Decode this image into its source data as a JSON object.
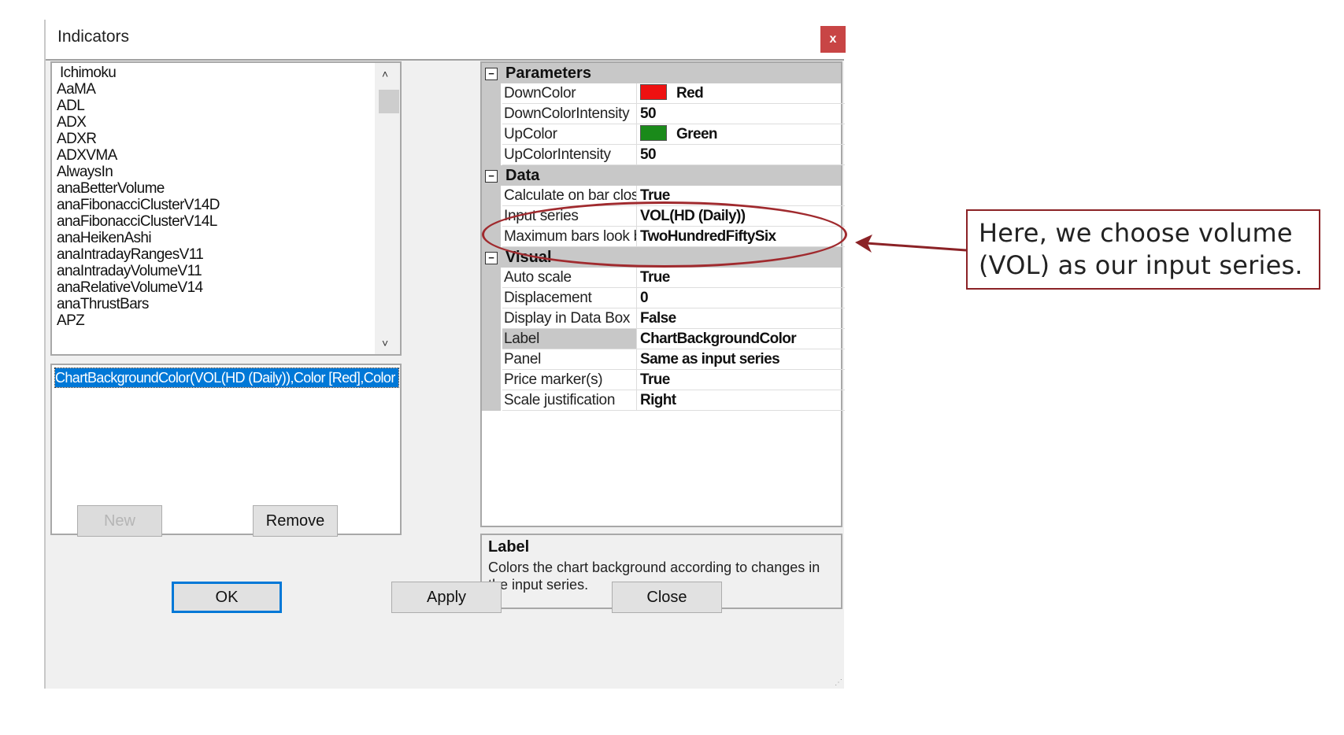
{
  "window": {
    "title": "Indicators",
    "close_glyph": "x"
  },
  "indicator_list": {
    "items": [
      "Ichimoku",
      "AaMA",
      "ADL",
      "ADX",
      "ADXR",
      "ADXVMA",
      "AlwaysIn",
      "anaBetterVolume",
      "anaFibonacciClusterV14D",
      "anaFibonacciClusterV14L",
      "anaHeikenAshi",
      "anaIntradayRangesV11",
      "anaIntradayVolumeV11",
      "anaRelativeVolumeV14",
      "anaThrustBars",
      "APZ"
    ]
  },
  "applied_list": {
    "selected_item": "ChartBackgroundColor(VOL(HD (Daily)),Color [Red],Color [Green])"
  },
  "buttons": {
    "new": "New",
    "remove": "Remove",
    "ok": "OK",
    "apply": "Apply",
    "close": "Close"
  },
  "property_grid": {
    "categories": [
      {
        "name": "Parameters",
        "rows": [
          {
            "name": "DownColor",
            "value": "Red",
            "swatch": "#ee1111"
          },
          {
            "name": "DownColorIntensity",
            "value": "50"
          },
          {
            "name": "UpColor",
            "value": "Green",
            "swatch": "#1a8a1a"
          },
          {
            "name": "UpColorIntensity",
            "value": "50"
          }
        ]
      },
      {
        "name": "Data",
        "rows": [
          {
            "name": "Calculate on bar close",
            "value": "True"
          },
          {
            "name": "Input series",
            "value": "VOL(HD (Daily))"
          },
          {
            "name": "Maximum bars look back",
            "value": "TwoHundredFiftySix"
          }
        ]
      },
      {
        "name": "Visual",
        "rows": [
          {
            "name": "Auto scale",
            "value": "True"
          },
          {
            "name": "Displacement",
            "value": "0"
          },
          {
            "name": "Display in Data Box",
            "value": "False"
          },
          {
            "name": "Label",
            "value": "ChartBackgroundColor"
          },
          {
            "name": "Panel",
            "value": "Same as input series"
          },
          {
            "name": "Price marker(s)",
            "value": "True"
          },
          {
            "name": "Scale justification",
            "value": "Right"
          }
        ]
      }
    ]
  },
  "description": {
    "title": "Label",
    "text": "Colors the chart background according to changes in the input series."
  },
  "annotation": {
    "callout_text": "Here, we choose volume (VOL) as our input series.",
    "color": "#8b2226"
  }
}
